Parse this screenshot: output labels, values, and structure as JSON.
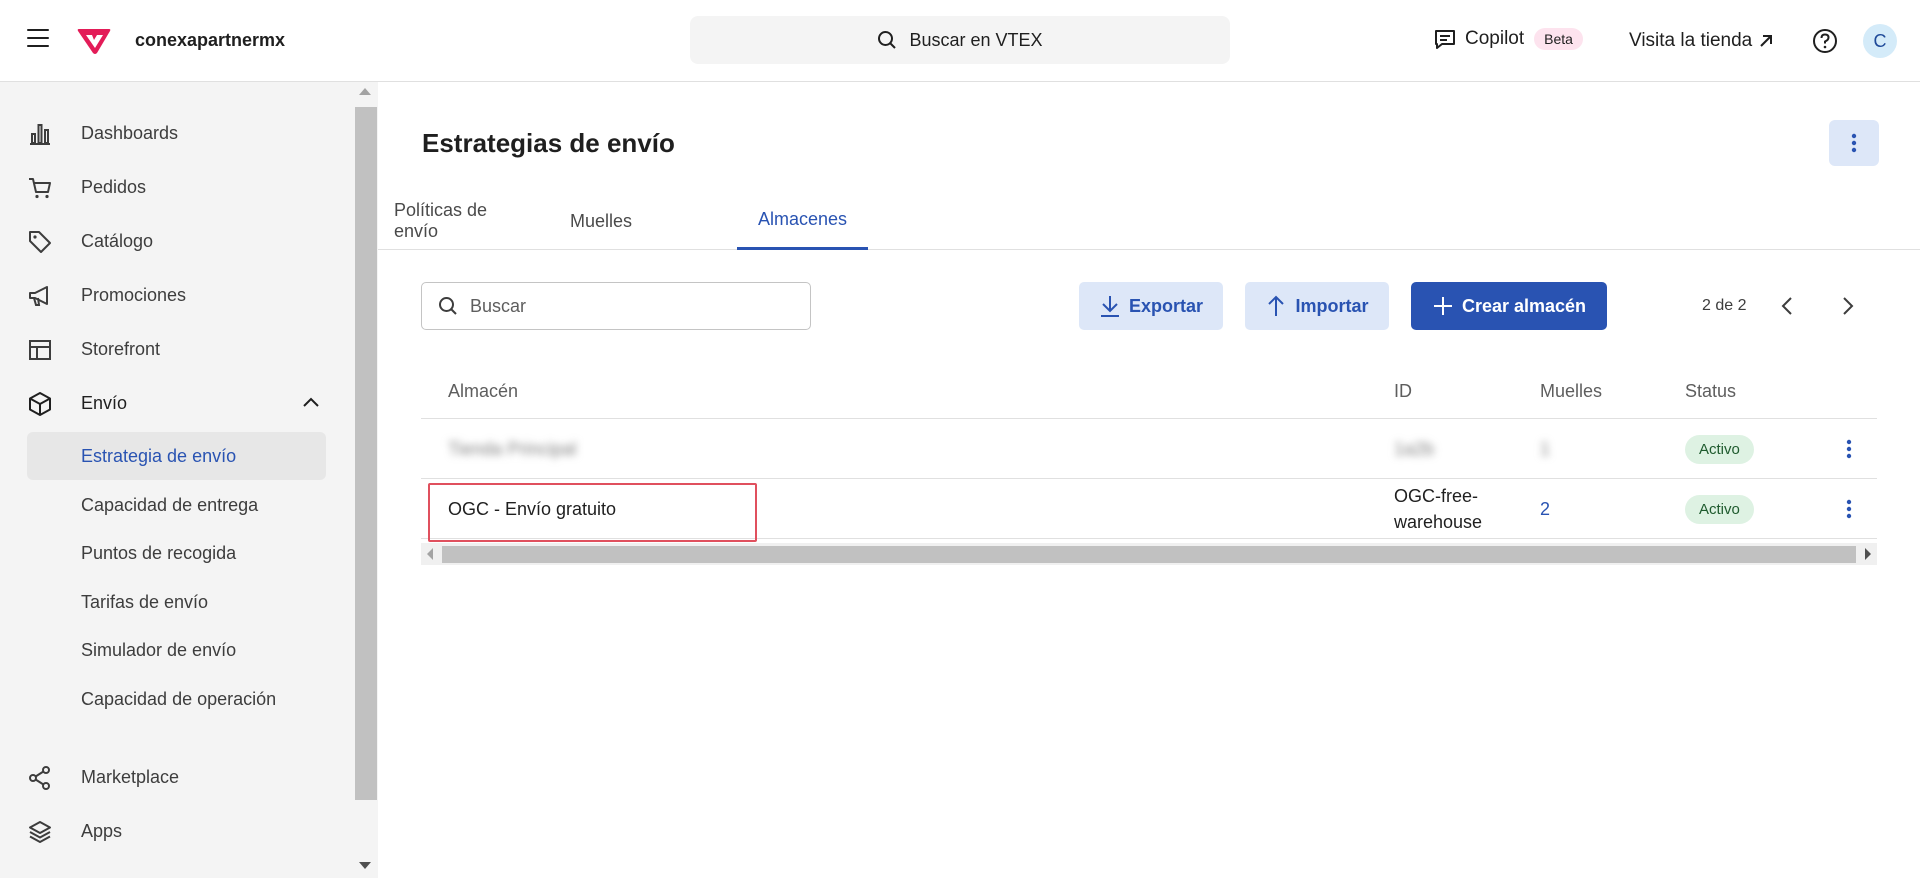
{
  "header": {
    "account": "conexapartnermx",
    "search_label": "Buscar en VTEX",
    "copilot_label": "Copilot",
    "beta_label": "Beta",
    "visit_store_label": "Visita la tienda",
    "avatar_initial": "C"
  },
  "sidebar": {
    "items": [
      {
        "label": "Dashboards",
        "icon": "bar-chart-icon"
      },
      {
        "label": "Pedidos",
        "icon": "cart-icon"
      },
      {
        "label": "Catálogo",
        "icon": "tag-icon"
      },
      {
        "label": "Promociones",
        "icon": "megaphone-icon"
      },
      {
        "label": "Storefront",
        "icon": "layout-icon"
      },
      {
        "label": "Envío",
        "icon": "box-icon"
      }
    ],
    "subitems": [
      {
        "label": "Estrategia de envío"
      },
      {
        "label": "Capacidad de entrega"
      },
      {
        "label": "Puntos de recogida"
      },
      {
        "label": "Tarifas de envío"
      },
      {
        "label": "Simulador de envío"
      },
      {
        "label": "Capacidad de operación"
      }
    ],
    "bottom_items": [
      {
        "label": "Marketplace",
        "icon": "share-icon"
      },
      {
        "label": "Apps",
        "icon": "layers-icon"
      }
    ]
  },
  "main": {
    "title": "Estrategias de envío",
    "tabs": [
      {
        "label": "Políticas de envío"
      },
      {
        "label": "Muelles"
      },
      {
        "label": "Almacenes"
      }
    ],
    "active_tab": "Almacenes",
    "search_placeholder": "Buscar",
    "export_label": "Exportar",
    "import_label": "Importar",
    "create_label": "Crear almacén",
    "pagination": "2 de 2",
    "table": {
      "columns": [
        "Almacén",
        "ID",
        "Muelles",
        "Status"
      ],
      "rows": [
        {
          "name": "Tienda Principal",
          "id": "1a2b",
          "docks": "1",
          "status": "Activo",
          "blurred": true
        },
        {
          "name": "OGC - Envío gratuito",
          "id_line1": "OGC-free-",
          "id_line2": "warehouse",
          "docks": "2",
          "status": "Activo",
          "blurred": false
        }
      ]
    }
  },
  "colors": {
    "accent": "#2953b2",
    "brand": "#e31c58",
    "active_badge_bg": "#def2e3",
    "highlight": "#e0505e"
  }
}
